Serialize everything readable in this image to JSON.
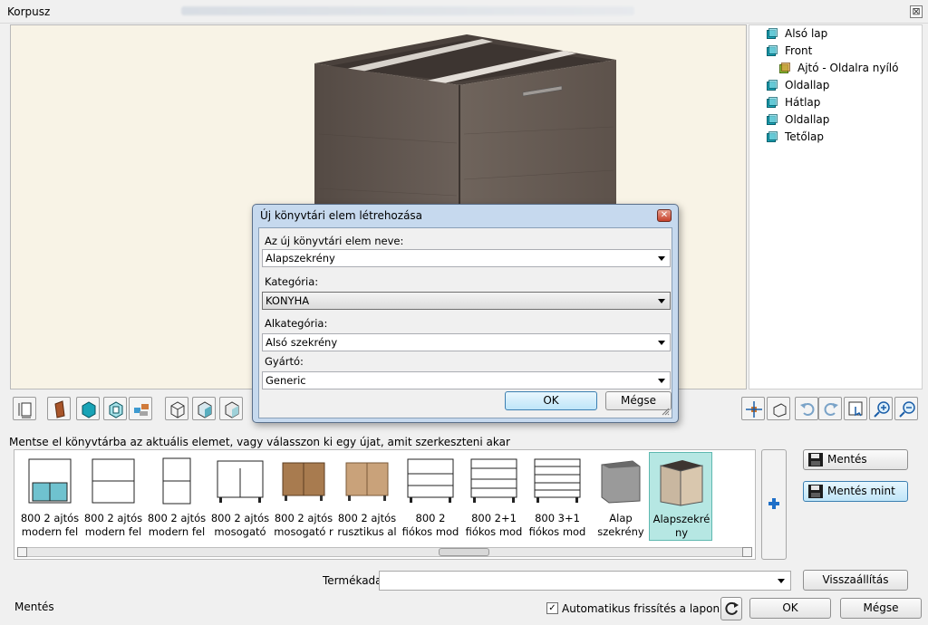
{
  "window": {
    "title": "Korpusz",
    "close_label": "⊠"
  },
  "tree": {
    "items": [
      {
        "label": "Alsó lap",
        "icon": "panel-icon"
      },
      {
        "label": "Front",
        "icon": "panel-icon"
      },
      {
        "label": "Ajtó - Oldalra nyíló",
        "icon": "door-icon"
      },
      {
        "label": "Oldallap",
        "icon": "panel-icon"
      },
      {
        "label": "Hátlap",
        "icon": "panel-icon"
      },
      {
        "label": "Oldallap",
        "icon": "panel-icon"
      },
      {
        "label": "Tetőlap",
        "icon": "panel-icon"
      }
    ]
  },
  "hint": "Mentse el könyvtárba az aktuális elemet, vagy válasszon ki egy újat, amit szerkeszteni akar",
  "library": {
    "items": [
      {
        "line1": "800 2 ajtós",
        "line2": "modern fel",
        "style": "glass"
      },
      {
        "line1": "800 2 ajtós",
        "line2": "modern fel",
        "style": "white"
      },
      {
        "line1": "800 2 ajtós",
        "line2": "modern fel",
        "style": "tall"
      },
      {
        "line1": "800 2 ajtós",
        "line2": "mosogató",
        "style": "white-legs"
      },
      {
        "line1": "800 2 ajtós",
        "line2": "mosogató r",
        "style": "wood-legs"
      },
      {
        "line1": "800 2 ajtós",
        "line2": "rusztikus al",
        "style": "wood-open"
      },
      {
        "line1": "800 2",
        "line2": "fiókos mod",
        "style": "drawers2"
      },
      {
        "line1": "800 2+1",
        "line2": "fiókos mod",
        "style": "drawers3"
      },
      {
        "line1": "800 3+1",
        "line2": "fiókos mod",
        "style": "drawers4"
      },
      {
        "line1": "Alap",
        "line2": "szekrény",
        "style": "grey"
      },
      {
        "line1": "Alapszekré",
        "line2": "ny",
        "style": "selected"
      }
    ]
  },
  "buttons": {
    "save": "Mentés",
    "save_as": "Mentés mint",
    "reset": "Visszaállítás",
    "ok": "OK",
    "cancel": "Mégse"
  },
  "product_data": {
    "label": "Termékadat",
    "value": ""
  },
  "status": {
    "text": "Mentés",
    "auto_refresh_label": "Automatikus frissítés a lapon",
    "auto_refresh_checked": true
  },
  "dialog": {
    "title": "Új könyvtári elem létrehozása",
    "name_label": "Az új könyvtári elem neve:",
    "name_value": "Alapszekrény",
    "category_label": "Kategória:",
    "category_value": "KONYHA",
    "subcategory_label": "Alkategória:",
    "subcategory_value": "Alsó szekrény",
    "manufacturer_label": "Gyártó:",
    "manufacturer_value": "Generic",
    "ok": "OK",
    "cancel": "Mégse"
  },
  "colors": {
    "viewport_bg": "#f8f3e6",
    "cabinet_wood": "#5d534c",
    "selected_item_bg": "#b6e7e3",
    "dialog_frame": "#c6d9ee"
  }
}
